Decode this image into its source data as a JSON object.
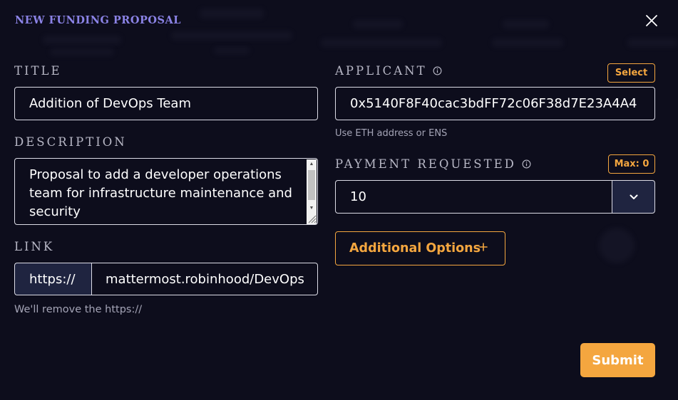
{
  "modal": {
    "title": "NEW FUNDING PROPOSAL",
    "close_icon": "close-icon"
  },
  "title_field": {
    "label": "TITLE",
    "value": "Addition of DevOps Team"
  },
  "description_field": {
    "label": "DESCRIPTION",
    "value": "Proposal to add a developer operations team for infrastructure maintenance and security"
  },
  "link_field": {
    "label": "LINK",
    "prefix": "https://",
    "value": "mattermost.robinhood/DevOps",
    "helper": "We'll remove the https://"
  },
  "applicant_field": {
    "label": "APPLICANT",
    "info_icon": "info-icon",
    "select_label": "Select",
    "value": "0x5140F8F40cac3bdFF72c06F38d7E23A4A4",
    "helper": "Use ETH address or ENS"
  },
  "payment_field": {
    "label": "PAYMENT REQUESTED",
    "info_icon": "info-icon",
    "max_label": "Max: 0",
    "value": "10",
    "token_icon": "chevron-down-icon"
  },
  "additional_options": {
    "label": "Additional Options",
    "icon": "plus-icon"
  },
  "submit": {
    "label": "Submit"
  },
  "colors": {
    "background": "#0d0d1c",
    "accent": "#f4a63f",
    "title": "#8b83e6",
    "label": "#b8b8c6",
    "field_border": "#dcdce6",
    "prefix_bg": "#1f2440"
  }
}
